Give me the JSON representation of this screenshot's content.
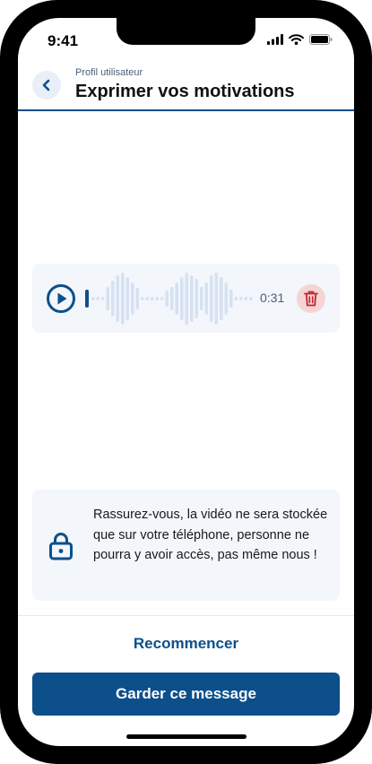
{
  "status_bar": {
    "time": "9:41"
  },
  "header": {
    "subtitle": "Profil utilisateur",
    "title": "Exprimer vos motivations"
  },
  "player": {
    "duration": "0:31",
    "progress": 0.0,
    "waveform": [
      4,
      4,
      4,
      26,
      40,
      52,
      58,
      48,
      36,
      24,
      4,
      4,
      4,
      4,
      4,
      18,
      26,
      36,
      48,
      58,
      52,
      44,
      26,
      36,
      52,
      58,
      48,
      36,
      20,
      4,
      4,
      4,
      4
    ],
    "colors": {
      "accent": "#0c4f8a",
      "wave": "#d6e1f3",
      "delete_bg": "#f5d4d6",
      "delete_icon": "#c1272d"
    }
  },
  "info": {
    "text": "Rassurez-vous, la vidéo ne sera stockée que sur votre téléphone, personne ne pourra y avoir accès, pas même nous !"
  },
  "actions": {
    "restart_label": "Recommencer",
    "keep_label": "Garder ce message"
  },
  "icons": {
    "back": "chevron-left-icon",
    "play": "play-icon",
    "delete": "trash-icon",
    "lock": "lock-icon"
  }
}
